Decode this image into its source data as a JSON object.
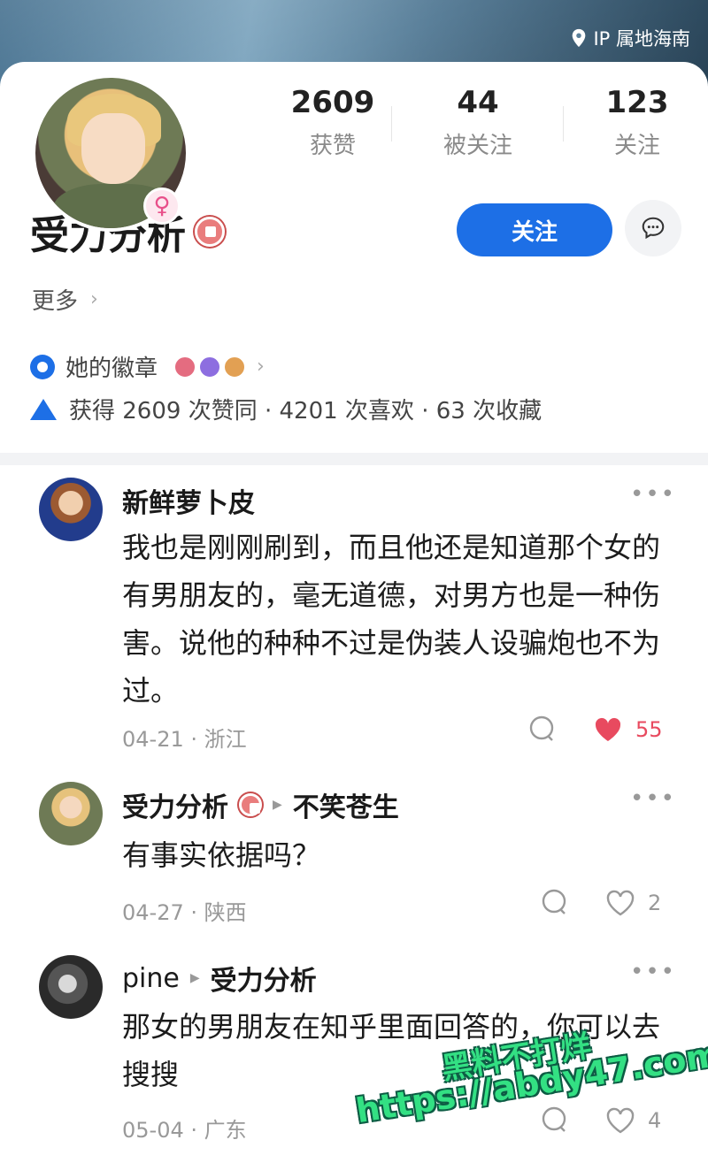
{
  "header": {
    "ip_location": "IP 属地海南"
  },
  "profile": {
    "gender_symbol": "♀",
    "stats": [
      {
        "value": "2609",
        "label": "获赞"
      },
      {
        "value": "44",
        "label": "被关注"
      },
      {
        "value": "123",
        "label": "关注"
      }
    ],
    "name": "受力分析",
    "follow_label": "关注",
    "more_label": "更多",
    "badges_label": "她的徽章",
    "summary": "获得 2609 次赞同 · 4201 次喜欢 · 63 次收藏"
  },
  "comments": [
    {
      "user": "新鲜萝卜皮",
      "reply_to": "",
      "text": "我也是刚刚刷到，而且他还是知道那个女的有男朋友的，毫无道德，对男方也是一种伤害。说他的种种不过是伪装人设骗炮也不为过。",
      "date": "04-21",
      "location": "浙江",
      "likes": "55",
      "liked": true
    },
    {
      "user": "受力分析",
      "reply_to": "不笑苍生",
      "text": "有事实依据吗？",
      "date": "04-27",
      "location": "陕西",
      "likes": "2",
      "liked": false
    },
    {
      "user": "pine",
      "reply_to": "受力分析",
      "text": "那女的男朋友在知乎里面回答的，你可以去搜搜",
      "date": "05-04",
      "location": "广东",
      "likes": "4",
      "liked": false
    }
  ],
  "watermark": {
    "line1": "黑料不打烊",
    "line2": "https://abdy47.com"
  },
  "colors": {
    "accent": "#1d6fe6",
    "like": "#e84a5f",
    "watermark": "#33e083"
  }
}
